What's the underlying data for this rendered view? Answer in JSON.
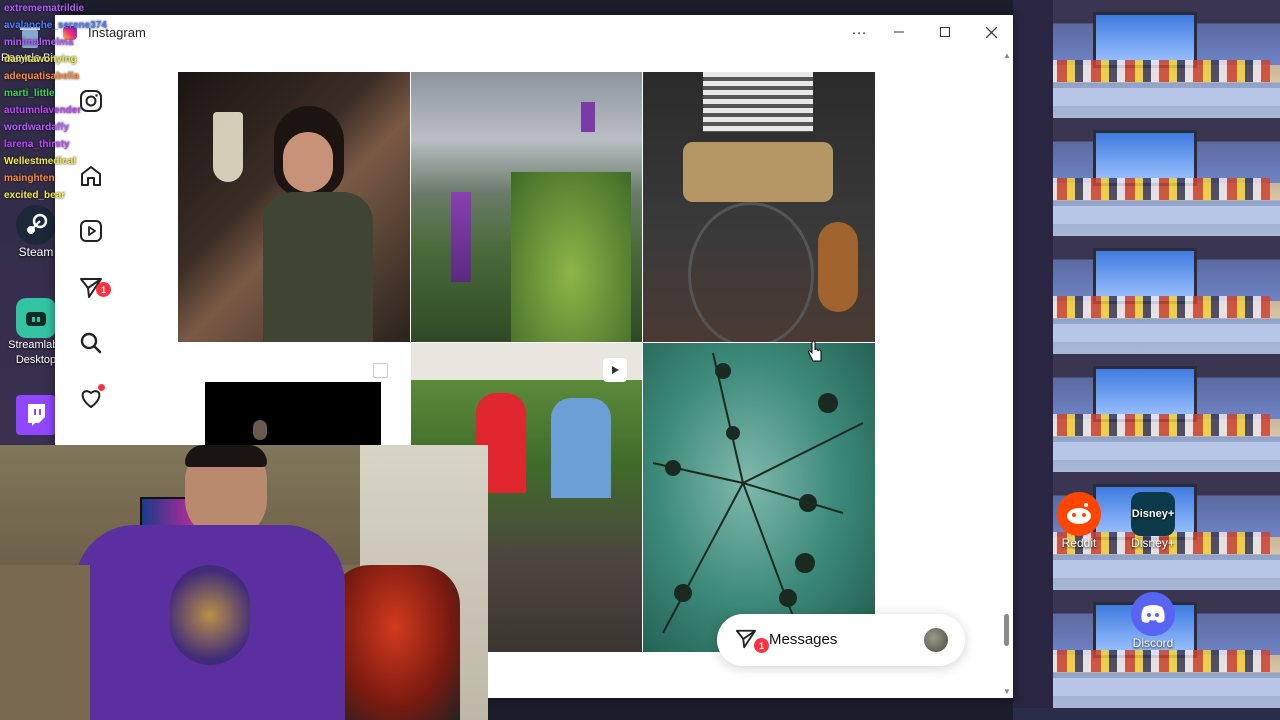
{
  "chat": [
    {
      "user": "extremematrildie",
      "color": "#b45cff"
    },
    {
      "user": "avalanche_serene374",
      "color": "#4d7bff"
    },
    {
      "user": "minimalmelma",
      "color": "#b45cff"
    },
    {
      "user": "damitawonying",
      "color": "#f2e94e"
    },
    {
      "user": "adequatisabella",
      "color": "#ff8c3a"
    },
    {
      "user": "marti_little",
      "color": "#3fd35a"
    },
    {
      "user": "autumnlavender",
      "color": "#c046ff"
    },
    {
      "user": "wordwardaffy",
      "color": "#b45cff"
    },
    {
      "user": "larena_thirsty",
      "color": "#c046ff"
    },
    {
      "user": "Wellestmedical",
      "color": "#f2e94e"
    },
    {
      "user": "mainghten",
      "color": "#ff8c3a"
    },
    {
      "user": "excited_bear",
      "color": "#f2e94e"
    }
  ],
  "window": {
    "title": "Instagram",
    "more_icon": "more-horizontal-icon",
    "min_icon": "minimize-icon",
    "max_icon": "maximize-icon",
    "close_icon": "close-icon"
  },
  "sidebar": {
    "items": [
      {
        "name": "instagram-logo-icon"
      },
      {
        "name": "home-icon"
      },
      {
        "name": "reels-icon"
      },
      {
        "name": "messages-icon",
        "badge": "1"
      },
      {
        "name": "search-icon"
      },
      {
        "name": "notifications-heart-icon"
      }
    ]
  },
  "messages_pill": {
    "label": "Messages",
    "badge": "1"
  },
  "desktop_icons": {
    "recycle_bin": "Recycle Bin",
    "steam": "Steam",
    "streamlabs": "Streamlabs Desktop",
    "reddit": "Reddit",
    "disney": "Disney+",
    "disney_logo": "Disney+",
    "discord": "Discord"
  },
  "colors": {
    "notification_red": "#ff3040",
    "reddit": "#ff4500",
    "discord": "#5865f2",
    "disney": "#0c3a4a",
    "streamlabs": "#31c3a2",
    "twitch": "#9146ff"
  }
}
